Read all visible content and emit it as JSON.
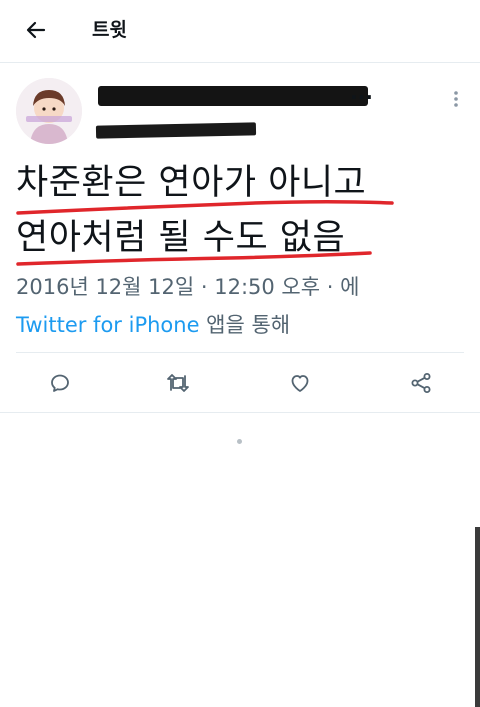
{
  "header": {
    "title": "트윗"
  },
  "tweet": {
    "display_name_suffix": "...",
    "text_lines": [
      "차준환은 연아가 아니고",
      "연아처럼 될 수도 없음"
    ],
    "timestamp": "2016년 12월 12일 · 12:50 오후 · 에",
    "source_app": "Twitter for iPhone",
    "source_suffix": " 앱을 통해"
  },
  "colors": {
    "link": "#1d9bf0",
    "secondary_text": "#536471",
    "underline": "#e0262b",
    "divider": "#e6ecf0"
  },
  "icons": {
    "back": "arrow-left-icon",
    "more": "more-vertical-icon",
    "reply": "reply-icon",
    "retweet": "retweet-icon",
    "like": "heart-icon",
    "share": "share-icon"
  }
}
